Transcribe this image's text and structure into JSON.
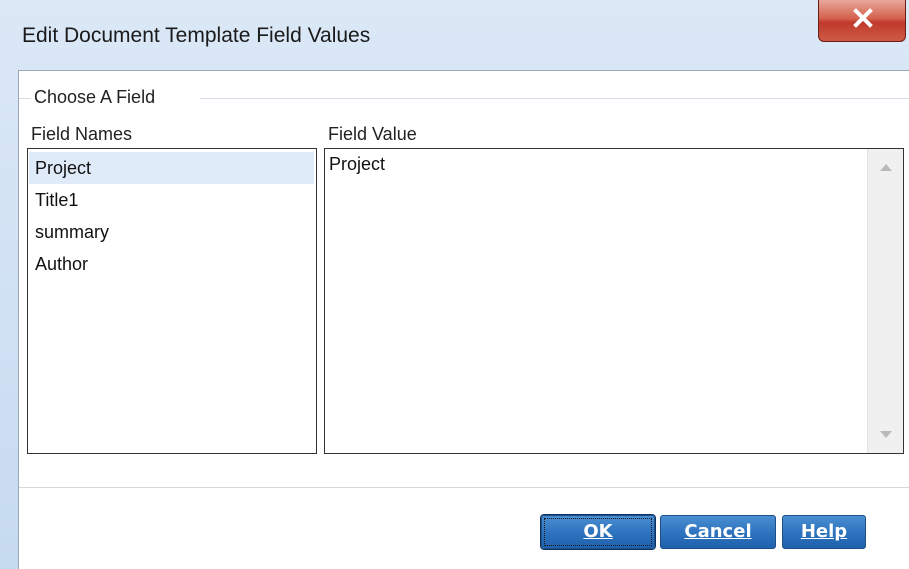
{
  "window": {
    "title": "Edit Document Template Field Values",
    "close_glyph": "X"
  },
  "group": {
    "label": "Choose A Field"
  },
  "field_names": {
    "header": "Field Names",
    "items": [
      {
        "label": "Project",
        "selected": true
      },
      {
        "label": "Title1",
        "selected": false
      },
      {
        "label": "summary",
        "selected": false
      },
      {
        "label": "Author",
        "selected": false
      }
    ]
  },
  "field_value": {
    "header": "Field Value",
    "value": "Project"
  },
  "buttons": {
    "ok": "OK",
    "cancel": "Cancel",
    "help": "Help"
  },
  "icons": {
    "close": "close-icon",
    "scroll_up": "scroll-up-arrow-icon",
    "scroll_down": "scroll-down-arrow-icon"
  },
  "colors": {
    "button": "#2f74bf",
    "close_button": "#c0392b",
    "selection": "#dfebf8"
  }
}
